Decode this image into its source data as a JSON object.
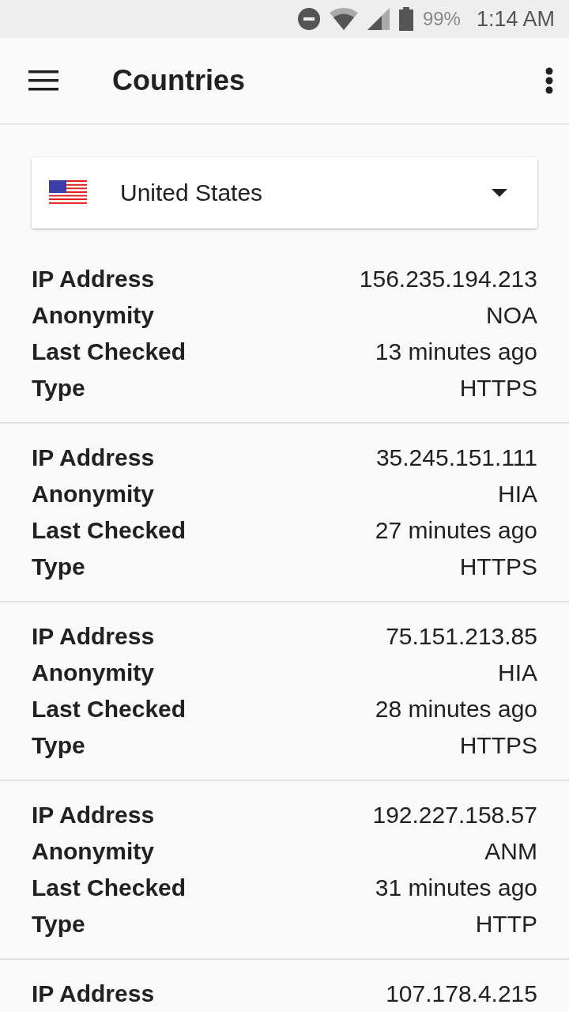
{
  "status_bar": {
    "battery": "99%",
    "time": "1:14 AM"
  },
  "app_bar": {
    "title": "Countries"
  },
  "country_select": {
    "value": "United States"
  },
  "proxies": [
    {
      "fields": [
        {
          "label": "IP Address",
          "value": "156.235.194.213"
        },
        {
          "label": "Anonymity",
          "value": "NOA"
        },
        {
          "label": "Last Checked",
          "value": "13 minutes ago"
        },
        {
          "label": "Type",
          "value": "HTTPS"
        }
      ]
    },
    {
      "fields": [
        {
          "label": "IP Address",
          "value": "35.245.151.111"
        },
        {
          "label": "Anonymity",
          "value": "HIA"
        },
        {
          "label": "Last Checked",
          "value": "27 minutes ago"
        },
        {
          "label": "Type",
          "value": "HTTPS"
        }
      ]
    },
    {
      "fields": [
        {
          "label": "IP Address",
          "value": "75.151.213.85"
        },
        {
          "label": "Anonymity",
          "value": "HIA"
        },
        {
          "label": "Last Checked",
          "value": "28 minutes ago"
        },
        {
          "label": "Type",
          "value": "HTTPS"
        }
      ]
    },
    {
      "fields": [
        {
          "label": "IP Address",
          "value": "192.227.158.57"
        },
        {
          "label": "Anonymity",
          "value": "ANM"
        },
        {
          "label": "Last Checked",
          "value": "31 minutes ago"
        },
        {
          "label": "Type",
          "value": "HTTP"
        }
      ]
    },
    {
      "fields": [
        {
          "label": "IP Address",
          "value": "107.178.4.215"
        }
      ]
    }
  ]
}
